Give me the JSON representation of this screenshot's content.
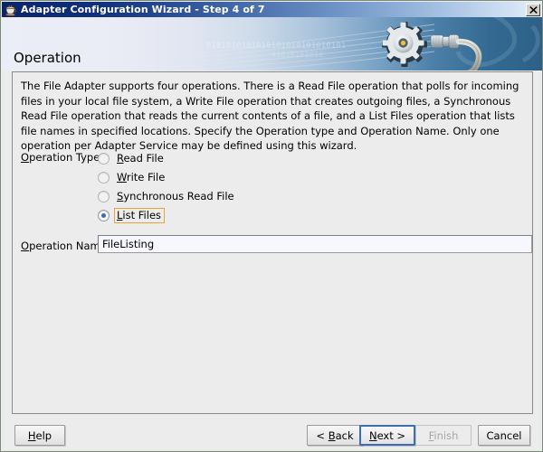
{
  "window": {
    "title": "Adapter Configuration Wizard - Step 4 of 7",
    "icon": "java-coffee-cup-icon",
    "close_label": "✕"
  },
  "banner": {
    "heading": "Operation",
    "binary_text": "0101010101010101010101010101",
    "binary_text2": "01010101010",
    "graphic": "gear-and-wrench-icon",
    "gradient_from": "#eceef7",
    "gradient_to": "#2c6087"
  },
  "content": {
    "description": "The File Adapter supports four operations.  There is a Read File operation that polls for incoming files in your local file system, a Write File operation that creates outgoing files, a Synchronous Read File operation that reads the current contents of a file, and a List Files operation that lists file names in specified locations.  Specify the Operation type and Operation Name.  Only one operation per Adapter Service may be defined using this wizard.",
    "operation_type": {
      "label": "Operation Type:",
      "label_mnemonic": "O",
      "selected": "List Files",
      "options": [
        {
          "label": "Read File",
          "mnemonic": "R",
          "rest": "ead File",
          "selected": false
        },
        {
          "label": "Write File",
          "mnemonic": "W",
          "rest": "rite File",
          "selected": false
        },
        {
          "label": "Synchronous Read File",
          "mnemonic": "S",
          "rest": "ynchronous Read File",
          "selected": false
        },
        {
          "label": "List Files",
          "mnemonic": "L",
          "rest": "ist Files",
          "selected": true
        }
      ]
    },
    "operation_name": {
      "label_mnemonic": "O",
      "label_rest": "peration Name:",
      "value": "FileListing",
      "placeholder": ""
    }
  },
  "buttons": {
    "help": {
      "mnemonic": "H",
      "before": "",
      "rest": "elp",
      "disabled": false,
      "default": false
    },
    "back": {
      "mnemonic": "B",
      "before": "< ",
      "rest": "ack",
      "disabled": false,
      "default": false
    },
    "next": {
      "mnemonic": "N",
      "before": "",
      "rest": "ext >",
      "disabled": false,
      "default": true
    },
    "finish": {
      "mnemonic": "F",
      "before": "",
      "rest": "inish",
      "disabled": true,
      "default": false
    },
    "cancel": {
      "mnemonic": "",
      "before": "Cancel",
      "rest": "",
      "disabled": false,
      "default": false
    }
  },
  "colors": {
    "titlebar_start": "#0a246a",
    "titlebar_end": "#e8f0fa",
    "focus_ring": "#e8a33d",
    "radio_dot": "#3a6ea5",
    "default_button_border": "#3b6fad",
    "panel_bg": "#ececec",
    "field_bg": "#f7f7ff"
  }
}
